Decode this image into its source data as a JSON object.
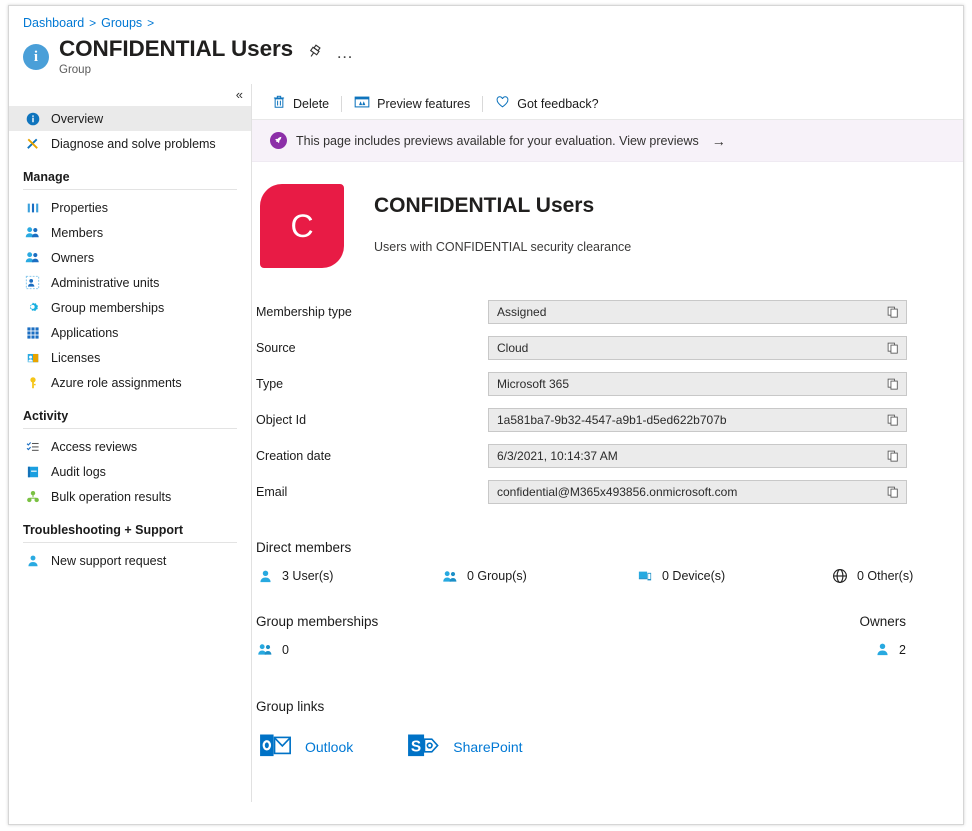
{
  "breadcrumb": {
    "items": [
      "Dashboard",
      "Groups"
    ],
    "separator": ">"
  },
  "header": {
    "title": "CONFIDENTIAL Users",
    "subtitle": "Group",
    "info_icon": "info-icon",
    "pin_icon": "pin-icon",
    "more_icon": "ellipsis-icon"
  },
  "sidebar": {
    "collapse_label": "«",
    "top_items": [
      {
        "label": "Overview",
        "icon": "info-icon",
        "selected": true
      },
      {
        "label": "Diagnose and solve problems",
        "icon": "wrench-icon",
        "selected": false
      }
    ],
    "groups": [
      {
        "title": "Manage",
        "items": [
          {
            "label": "Properties",
            "icon": "properties-icon"
          },
          {
            "label": "Members",
            "icon": "members-icon"
          },
          {
            "label": "Owners",
            "icon": "owners-icon"
          },
          {
            "label": "Administrative units",
            "icon": "administrative-units-icon"
          },
          {
            "label": "Group memberships",
            "icon": "group-memberships-icon"
          },
          {
            "label": "Applications",
            "icon": "applications-icon"
          },
          {
            "label": "Licenses",
            "icon": "licenses-icon"
          },
          {
            "label": "Azure role assignments",
            "icon": "key-icon"
          }
        ]
      },
      {
        "title": "Activity",
        "items": [
          {
            "label": "Access reviews",
            "icon": "access-reviews-icon"
          },
          {
            "label": "Audit logs",
            "icon": "audit-logs-icon"
          },
          {
            "label": "Bulk operation results",
            "icon": "bulk-operation-icon"
          }
        ]
      },
      {
        "title": "Troubleshooting + Support",
        "items": [
          {
            "label": "New support request",
            "icon": "support-request-icon"
          }
        ]
      }
    ]
  },
  "toolbar": {
    "delete_label": "Delete",
    "preview_features_label": "Preview features",
    "feedback_label": "Got feedback?"
  },
  "preview_banner": {
    "text": "This page includes previews available for your evaluation. View previews",
    "arrow": "→",
    "background": "#f7f2f9",
    "icon_color": "#8c2fa8"
  },
  "group": {
    "avatar_letter": "C",
    "avatar_color": "#e81b45",
    "name": "CONFIDENTIAL Users",
    "description": "Users with CONFIDENTIAL security clearance"
  },
  "properties": [
    {
      "label": "Membership type",
      "value": "Assigned"
    },
    {
      "label": "Source",
      "value": "Cloud"
    },
    {
      "label": "Type",
      "value": "Microsoft 365"
    },
    {
      "label": "Object Id",
      "value": "1a581ba7-9b32-4547-a9b1-d5ed622b707b"
    },
    {
      "label": "Creation date",
      "value": "6/3/2021, 10:14:37 AM"
    },
    {
      "label": "Email",
      "value": "confidential@M365x493856.onmicrosoft.com"
    }
  ],
  "direct_members": {
    "heading": "Direct members",
    "stats": [
      {
        "label": "3 User(s)",
        "icon": "user-icon"
      },
      {
        "label": "0 Group(s)",
        "icon": "group-icon"
      },
      {
        "label": "0 Device(s)",
        "icon": "device-icon"
      },
      {
        "label": "0 Other(s)",
        "icon": "globe-icon"
      }
    ]
  },
  "memberships": {
    "heading": "Group memberships",
    "value": "0",
    "icon": "group-icon"
  },
  "owners": {
    "heading": "Owners",
    "value": "2",
    "icon": "user-icon"
  },
  "group_links": {
    "heading": "Group links",
    "items": [
      {
        "label": "Outlook",
        "icon": "outlook-icon"
      },
      {
        "label": "SharePoint",
        "icon": "sharepoint-icon"
      }
    ]
  }
}
